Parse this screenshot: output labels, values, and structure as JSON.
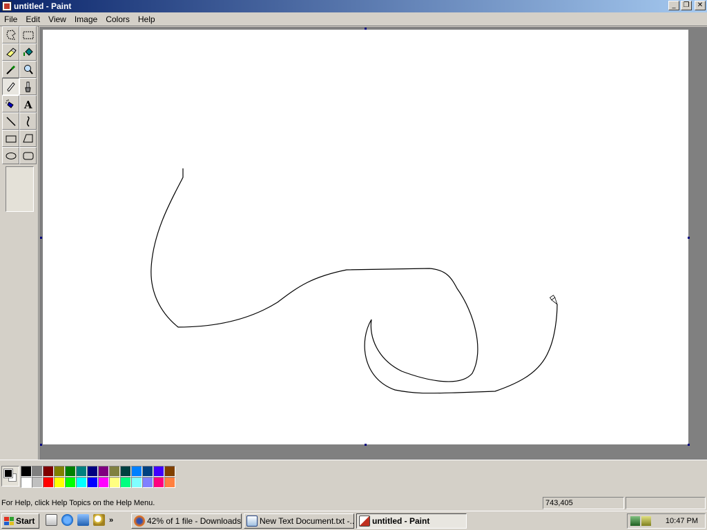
{
  "window": {
    "title": "untitled - Paint",
    "controls": [
      "minimize",
      "restore",
      "close"
    ]
  },
  "menu": [
    "File",
    "Edit",
    "View",
    "Image",
    "Colors",
    "Help"
  ],
  "tools": [
    {
      "name": "free-form-select",
      "icon": "free-select-icon"
    },
    {
      "name": "select",
      "icon": "rect-select-icon"
    },
    {
      "name": "eraser",
      "icon": "eraser-icon"
    },
    {
      "name": "fill",
      "icon": "fill-bucket-icon"
    },
    {
      "name": "pick-color",
      "icon": "eyedropper-icon"
    },
    {
      "name": "magnifier",
      "icon": "magnifier-icon"
    },
    {
      "name": "pencil",
      "icon": "pencil-icon",
      "active": true
    },
    {
      "name": "brush",
      "icon": "brush-icon"
    },
    {
      "name": "airbrush",
      "icon": "airbrush-icon"
    },
    {
      "name": "text",
      "icon": "text-icon"
    },
    {
      "name": "line",
      "icon": "line-icon"
    },
    {
      "name": "curve",
      "icon": "curve-icon"
    },
    {
      "name": "rectangle",
      "icon": "rectangle-icon"
    },
    {
      "name": "polygon",
      "icon": "polygon-icon"
    },
    {
      "name": "ellipse",
      "icon": "ellipse-icon"
    },
    {
      "name": "rounded-rectangle",
      "icon": "rounded-rect-icon"
    }
  ],
  "colors": {
    "foreground": "#000000",
    "background": "#ffffff",
    "palette_top": [
      "#000000",
      "#808080",
      "#800000",
      "#808000",
      "#008000",
      "#008080",
      "#000080",
      "#800080",
      "#808040",
      "#004040",
      "#0080ff",
      "#004080",
      "#4000ff",
      "#804000"
    ],
    "palette_bottom": [
      "#ffffff",
      "#c0c0c0",
      "#ff0000",
      "#ffff00",
      "#00ff00",
      "#00ffff",
      "#0000ff",
      "#ff00ff",
      "#ffff80",
      "#00ff80",
      "#80ffff",
      "#8080ff",
      "#ff0080",
      "#ff8040"
    ]
  },
  "status": {
    "help_text": "For Help, click Help Topics on the Help Menu.",
    "coords": "743,405"
  },
  "taskbar": {
    "start_label": "Start",
    "quick_launch": [
      "show-desktop-icon",
      "internet-explorer-icon",
      "outlook-express-icon",
      "search-icon"
    ],
    "more": "»",
    "buttons": [
      {
        "label": "42% of 1 file - Downloads",
        "icon": "firefox-icon",
        "active": false
      },
      {
        "label": "New Text Document.txt -...",
        "icon": "notepad-icon",
        "active": false
      },
      {
        "label": "untitled - Paint",
        "icon": "paint-icon",
        "active": true
      }
    ],
    "clock": "10:47 PM"
  }
}
